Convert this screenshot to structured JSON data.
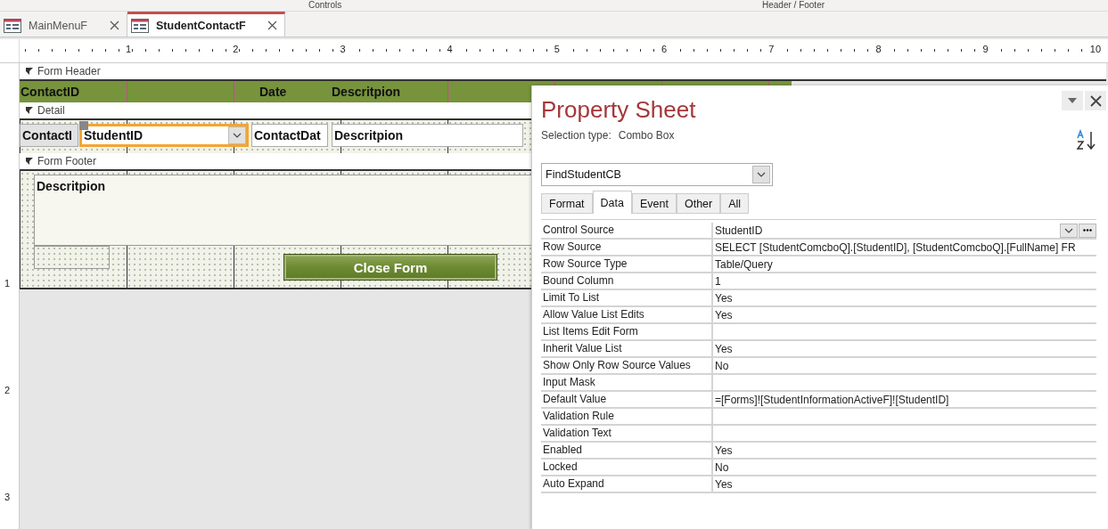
{
  "ribbon": {
    "groups": [
      "Controls",
      "Header / Footer"
    ]
  },
  "tabs": [
    {
      "label": "MainMenuF",
      "selected": false
    },
    {
      "label": "StudentContactF",
      "selected": true
    }
  ],
  "ruler": {
    "marks": [
      "1",
      "2",
      "3",
      "4",
      "5",
      "6",
      "7",
      "8",
      "9",
      "10"
    ]
  },
  "vertical_ruler": {
    "marks": [
      "1",
      "2",
      "3"
    ]
  },
  "form": {
    "sections": [
      {
        "title": "Form Header",
        "kind": "header",
        "controls": [
          {
            "kind": "label",
            "text": "ContactID"
          },
          {
            "kind": "label",
            "text": "Date"
          },
          {
            "kind": "label",
            "text": "Descritpion"
          }
        ]
      },
      {
        "title": "Detail",
        "kind": "detail",
        "controls": [
          {
            "kind": "label",
            "text": "ContactI",
            "selected": false
          },
          {
            "kind": "combo",
            "text": "StudentID",
            "selected": true
          },
          {
            "kind": "textbox",
            "text": "ContactDat",
            "selected": false
          },
          {
            "kind": "textbox",
            "text": "Descritpion",
            "selected": false
          }
        ]
      },
      {
        "title": "Form Footer",
        "kind": "footer",
        "controls": [
          {
            "kind": "textarea",
            "text": "Descritpion"
          },
          {
            "kind": "button",
            "text": "Close Form"
          }
        ]
      }
    ]
  },
  "property_sheet": {
    "title": "Property Sheet",
    "selection_type_label": "Selection type:",
    "selection_type": "Combo Box",
    "object": "FindStudentCB",
    "tabs": [
      {
        "label": "Format",
        "selected": false
      },
      {
        "label": "Data",
        "selected": true
      },
      {
        "label": "Event",
        "selected": false
      },
      {
        "label": "Other",
        "selected": false
      },
      {
        "label": "All",
        "selected": false
      }
    ],
    "properties": [
      {
        "name": "Control Source",
        "value": "StudentID",
        "kind": "combo"
      },
      {
        "name": "Row Source",
        "value": "SELECT [StudentComcboQ].[StudentID], [StudentComcboQ].[FullName] FR",
        "kind": "text"
      },
      {
        "name": "Row Source Type",
        "value": "Table/Query",
        "kind": "text"
      },
      {
        "name": "Bound Column",
        "value": "1",
        "kind": "text"
      },
      {
        "name": "Limit To List",
        "value": "Yes",
        "kind": "text"
      },
      {
        "name": "Allow Value List Edits",
        "value": "Yes",
        "kind": "text"
      },
      {
        "name": "List Items Edit Form",
        "kind": "text"
      },
      {
        "name": "Inherit Value List",
        "value": "Yes",
        "kind": "text"
      },
      {
        "name": "Show Only Row Source Values",
        "value": "No",
        "kind": "text"
      },
      {
        "name": "Input Mask",
        "kind": "text"
      },
      {
        "name": "Default Value",
        "value": "=[Forms]![StudentInformationActiveF]![StudentID]",
        "kind": "text"
      },
      {
        "name": "Validation Rule",
        "kind": "text"
      },
      {
        "name": "Validation Text",
        "kind": "text"
      },
      {
        "name": "Enabled",
        "value": "Yes",
        "kind": "text"
      },
      {
        "name": "Locked",
        "value": "No",
        "kind": "text"
      },
      {
        "name": "Auto Expand",
        "value": "Yes",
        "kind": "text"
      }
    ]
  }
}
